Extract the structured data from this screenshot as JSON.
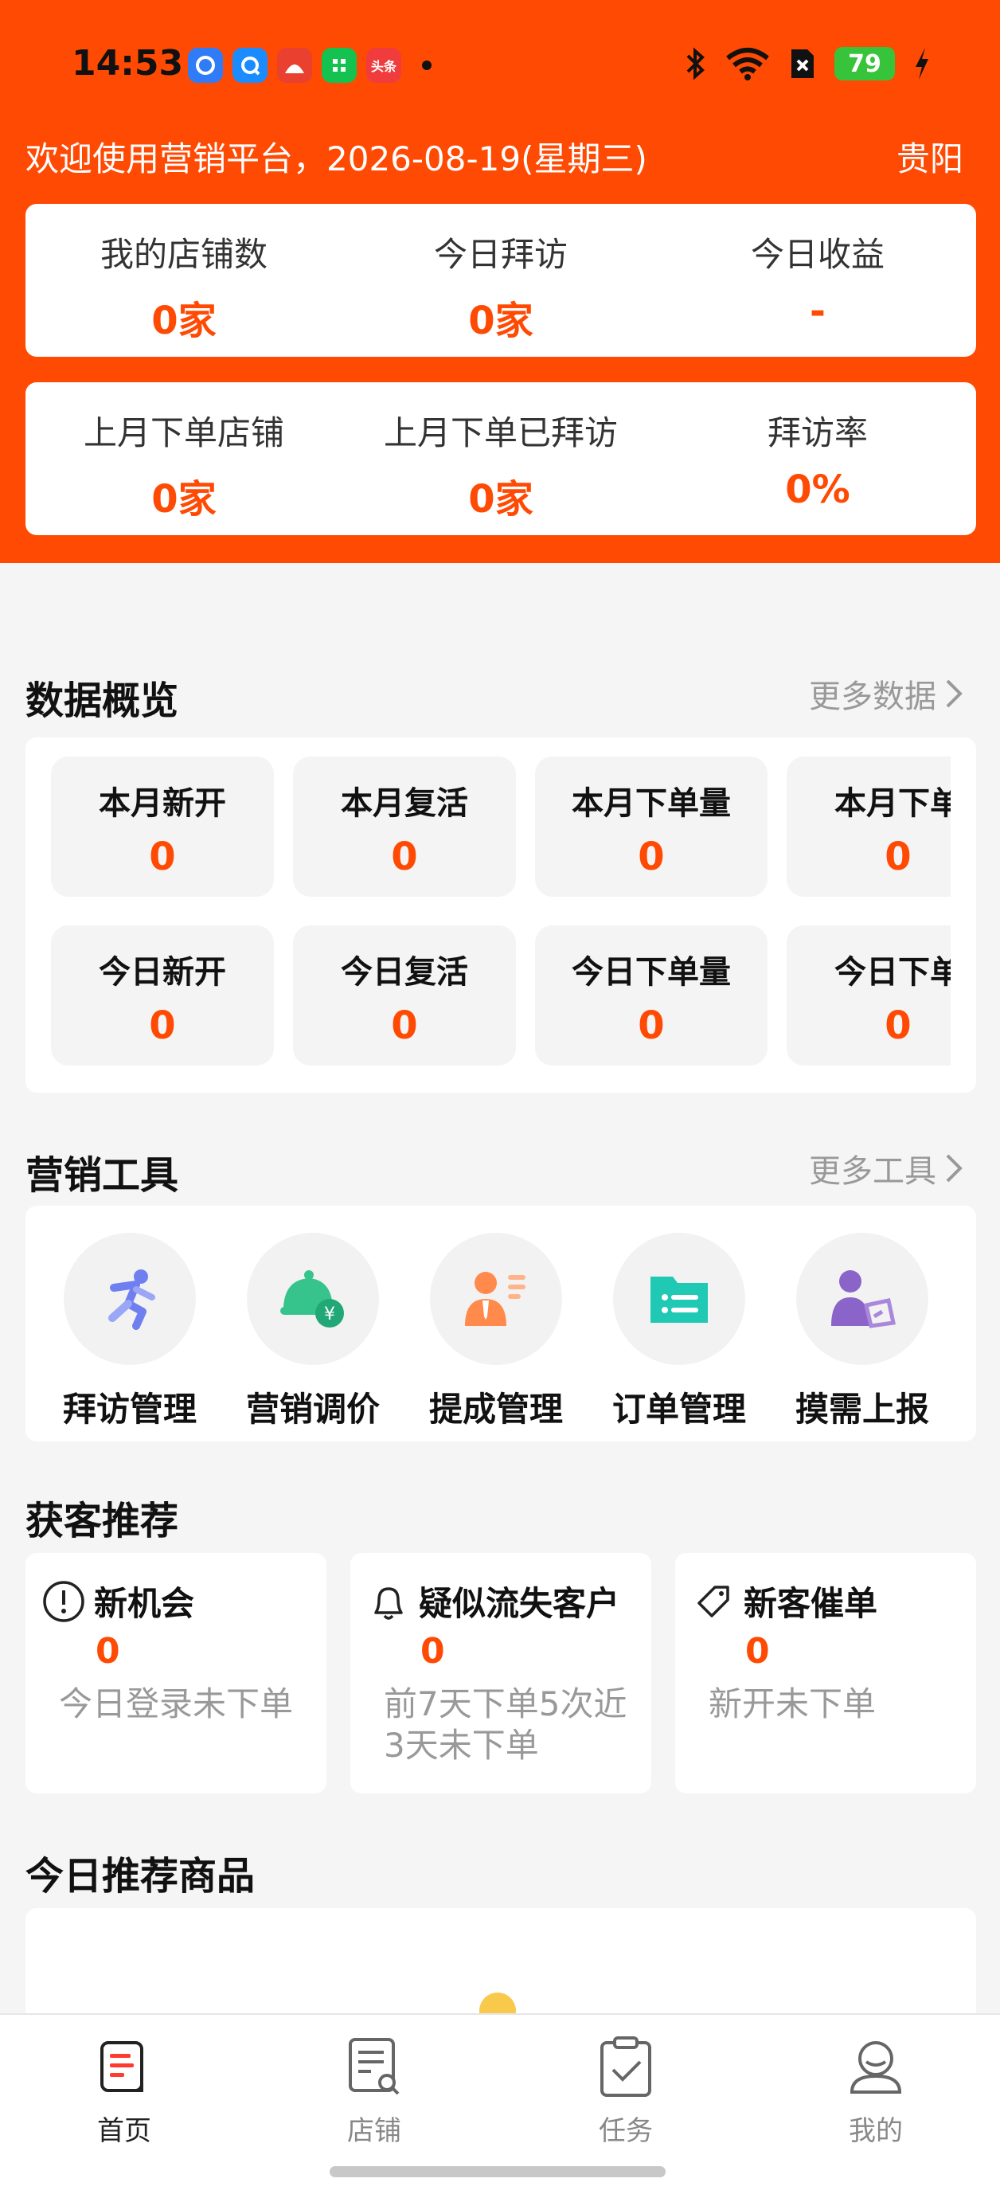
{
  "status_bar": {
    "time": "14:53",
    "battery": "79",
    "app_icons": [
      "browser-app-icon",
      "qq-browser-icon",
      "fire-app-icon",
      "wechat-mini-icon",
      "toutiao-icon"
    ],
    "toutiao_label": "头条"
  },
  "header": {
    "welcome": "欢迎使用营销平台，2026-08-19(星期三)",
    "city": "贵阳"
  },
  "stats_top": [
    {
      "label": "我的店铺数",
      "value": "0家"
    },
    {
      "label": "今日拜访",
      "value": "0家"
    },
    {
      "label": "今日收益",
      "value": "-"
    }
  ],
  "stats_bottom": [
    {
      "label": "上月下单店铺",
      "value": "0家"
    },
    {
      "label": "上月下单已拜访",
      "value": "0家"
    },
    {
      "label": "拜访率",
      "value": "0%"
    }
  ],
  "overview": {
    "title": "数据概览",
    "more": "更多数据",
    "row1": [
      {
        "label": "本月新开",
        "value": "0"
      },
      {
        "label": "本月复活",
        "value": "0"
      },
      {
        "label": "本月下单量",
        "value": "0"
      },
      {
        "label": "本月下单",
        "value": "0"
      }
    ],
    "row2": [
      {
        "label": "今日新开",
        "value": "0"
      },
      {
        "label": "今日复活",
        "value": "0"
      },
      {
        "label": "今日下单量",
        "value": "0"
      },
      {
        "label": "今日下单",
        "value": "0"
      }
    ]
  },
  "tools": {
    "title": "营销工具",
    "more": "更多工具",
    "items": [
      {
        "label": "拜访管理",
        "icon": "running-person-icon"
      },
      {
        "label": "营销调价",
        "icon": "price-bell-icon"
      },
      {
        "label": "提成管理",
        "icon": "commission-person-icon"
      },
      {
        "label": "订单管理",
        "icon": "order-list-icon"
      },
      {
        "label": "摸需上报",
        "icon": "report-person-icon"
      }
    ]
  },
  "recommend": {
    "title": "获客推荐",
    "items": [
      {
        "title": "新机会",
        "value": "0",
        "desc": "今日登录未下单",
        "icon": "alert-circle-icon"
      },
      {
        "title": "疑似流失客户",
        "value": "0",
        "desc": "前7天下单5次近3天未下单",
        "icon": "bell-icon"
      },
      {
        "title": "新客催单",
        "value": "0",
        "desc": "新开未下单",
        "icon": "tag-icon"
      }
    ]
  },
  "goods": {
    "title": "今日推荐商品"
  },
  "tabbar": [
    {
      "label": "首页",
      "icon": "home-doc-icon",
      "active": true
    },
    {
      "label": "店铺",
      "icon": "shop-search-icon",
      "active": false
    },
    {
      "label": "任务",
      "icon": "task-clipboard-icon",
      "active": false
    },
    {
      "label": "我的",
      "icon": "profile-icon",
      "active": false
    }
  ],
  "colors": {
    "brand": "#ff4a04",
    "value": "#ff4a04",
    "muted": "#999999"
  }
}
